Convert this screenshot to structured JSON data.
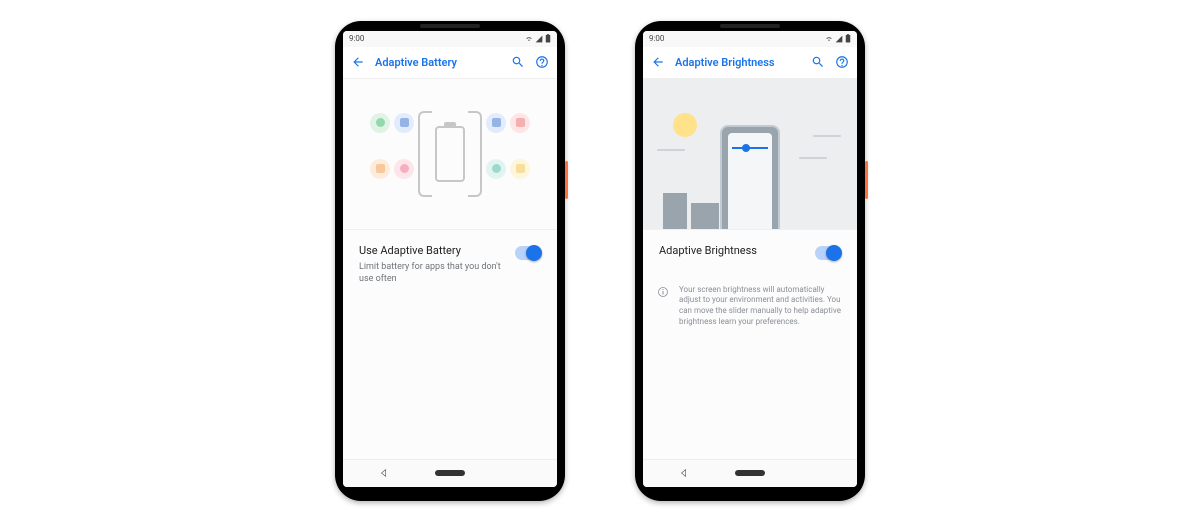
{
  "status": {
    "time": "9:00"
  },
  "phone1": {
    "title": "Adaptive Battery",
    "toggle": {
      "title": "Use Adaptive Battery",
      "subtitle": "Limit battery for apps that you don't use often",
      "on": true
    }
  },
  "phone2": {
    "title": "Adaptive Brightness",
    "toggle": {
      "title": "Adaptive Brightness",
      "on": true
    },
    "info": "Your screen brightness will automatically adjust to your environment and activities. You can move the slider manually to help adaptive brightness learn your preferences."
  },
  "colors": {
    "accent": "#1a73e8"
  }
}
